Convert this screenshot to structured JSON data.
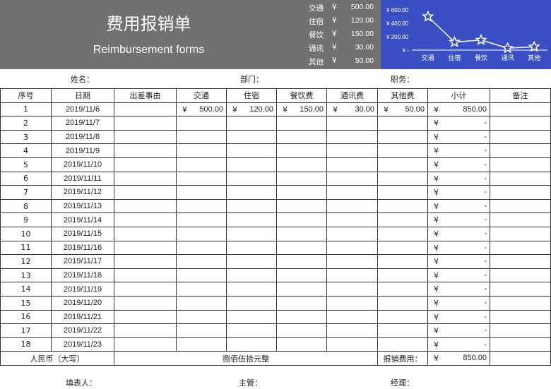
{
  "header": {
    "title_cn": "费用报销单",
    "title_en": "Reimbursement forms"
  },
  "summary": [
    {
      "label": "交通",
      "yen": "¥",
      "value": "500.00"
    },
    {
      "label": "住宿",
      "yen": "¥",
      "value": "120.00"
    },
    {
      "label": "餐饮",
      "yen": "¥",
      "value": "150.00"
    },
    {
      "label": "通讯",
      "yen": "¥",
      "value": "30.00"
    },
    {
      "label": "其他",
      "yen": "¥",
      "value": "50.00"
    }
  ],
  "chart_data": {
    "type": "line",
    "categories": [
      "交通",
      "住宿",
      "餐饮",
      "通讯",
      "其他"
    ],
    "values": [
      500,
      120,
      150,
      30,
      50
    ],
    "y_tick_labels": [
      "¥ 600.00",
      "¥ 400.00",
      "¥ 200.00",
      "¥ -"
    ],
    "ylim": [
      0,
      600
    ],
    "colors": {
      "background": "#3b4fc5",
      "line": "#ffffff",
      "text": "#ffffff"
    }
  },
  "info": {
    "name_label": "姓名：",
    "dept_label": "部门：",
    "position_label": "职务："
  },
  "table": {
    "headers": [
      "序号",
      "日期",
      "出差事由",
      "交通",
      "住宿",
      "餐饮费",
      "通讯费",
      "其他费",
      "小计",
      "备注"
    ],
    "rows": [
      {
        "no": "1",
        "date": "2019/11/6",
        "transport": "500.00",
        "lodging": "120.00",
        "meals": "150.00",
        "comm": "30.00",
        "other": "50.00",
        "subtotal": "850.00"
      },
      {
        "no": "2",
        "date": "2019/11/7",
        "subtotal": "-"
      },
      {
        "no": "3",
        "date": "2019/11/8",
        "subtotal": "-"
      },
      {
        "no": "4",
        "date": "2019/11/9",
        "subtotal": "-"
      },
      {
        "no": "5",
        "date": "2019/11/10",
        "subtotal": "-"
      },
      {
        "no": "6",
        "date": "2019/11/11",
        "subtotal": "-"
      },
      {
        "no": "7",
        "date": "2019/11/12",
        "subtotal": "-"
      },
      {
        "no": "8",
        "date": "2019/11/13",
        "subtotal": "-"
      },
      {
        "no": "9",
        "date": "2019/11/14",
        "subtotal": "-"
      },
      {
        "no": "10",
        "date": "2019/11/15",
        "subtotal": "-"
      },
      {
        "no": "11",
        "date": "2019/11/16",
        "subtotal": "-"
      },
      {
        "no": "12",
        "date": "2019/11/17",
        "subtotal": "-"
      },
      {
        "no": "13",
        "date": "2019/11/18",
        "subtotal": "-"
      },
      {
        "no": "14",
        "date": "2019/11/19",
        "subtotal": "-"
      },
      {
        "no": "15",
        "date": "2019/11/20",
        "subtotal": "-"
      },
      {
        "no": "16",
        "date": "2019/11/21",
        "subtotal": "-"
      },
      {
        "no": "17",
        "date": "2019/11/22",
        "subtotal": "-"
      },
      {
        "no": "18",
        "date": "2019/11/23",
        "subtotal": "-"
      }
    ],
    "yen": "¥",
    "total_row": {
      "label": "人民币（大写）",
      "amount_words": "捌佰伍拾元整",
      "claim_label": "报销费用：",
      "claim_value": "850.00"
    }
  },
  "footer": {
    "filler_label": "填表人：",
    "supervisor_label": "主管：",
    "manager_label": "经理："
  }
}
